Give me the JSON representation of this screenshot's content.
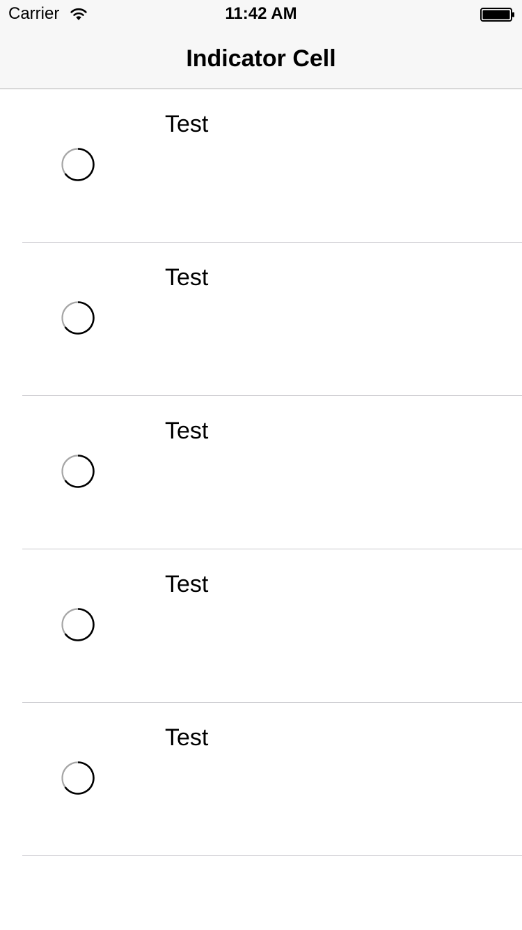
{
  "status_bar": {
    "carrier": "Carrier",
    "time": "11:42 AM",
    "icons": [
      "wifi-icon",
      "battery-icon"
    ]
  },
  "nav_bar": {
    "title": "Indicator Cell"
  },
  "table": {
    "cells": [
      {
        "label": "Test",
        "indicator": "progress-ring-icon"
      },
      {
        "label": "Test",
        "indicator": "progress-ring-icon"
      },
      {
        "label": "Test",
        "indicator": "progress-ring-icon"
      },
      {
        "label": "Test",
        "indicator": "progress-ring-icon"
      },
      {
        "label": "Test",
        "indicator": "progress-ring-icon"
      }
    ]
  },
  "colors": {
    "nav_background": "#f7f7f7",
    "separator": "#c8c7cc",
    "indicator_track": "#a6a6a6",
    "indicator_arc": "#000000"
  }
}
